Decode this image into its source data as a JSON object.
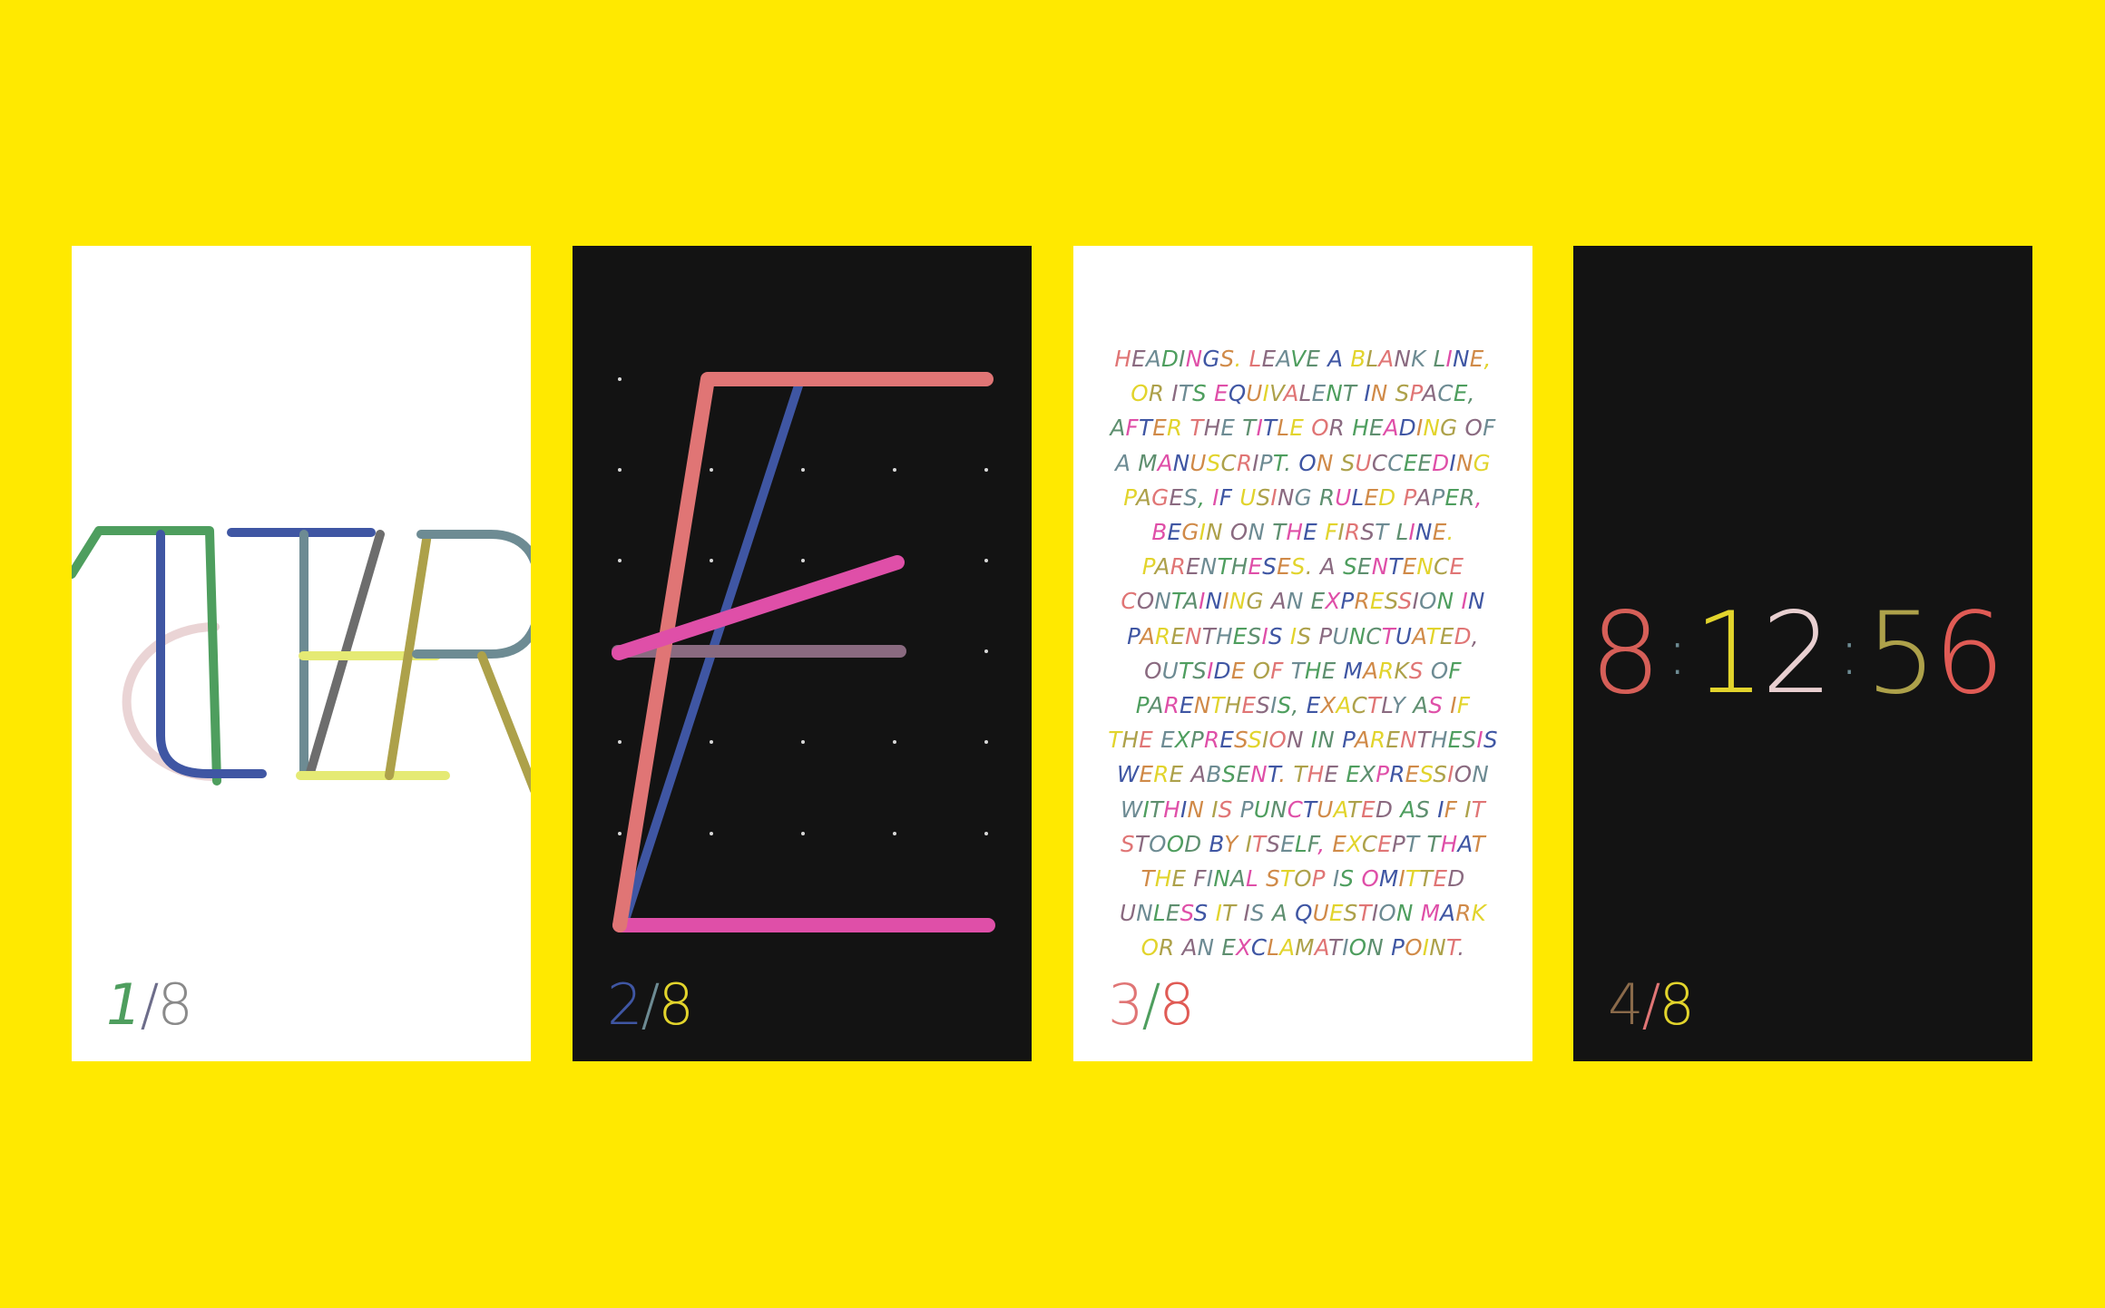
{
  "palette": {
    "background": "#ffe900",
    "green": "#4e9e5e",
    "blue": "#3f56a3",
    "slate": "#6d8b93",
    "olive": "#ada14a",
    "pink": "#e8cfd0",
    "lime": "#e5ea74",
    "salmon": "#e07575",
    "magenta": "#df4fa8",
    "yellow": "#e2d42c",
    "grey": "#8a8a8a",
    "coral": "#e05b55"
  },
  "cards": [
    {
      "theme": "white",
      "pager": {
        "current": "1",
        "separator": "/",
        "total": "8"
      }
    },
    {
      "theme": "dark",
      "pager": {
        "current": "2",
        "separator": "/",
        "total": "8"
      }
    },
    {
      "theme": "white",
      "pager": {
        "current": "3",
        "separator": "/",
        "total": "8"
      },
      "verse_lines": [
        "HEADINGS. LEAVE A BLANK LINE,",
        "OR ITS EQUIVALENT IN SPACE,",
        "AFTER THE TITLE OR HEADING OF",
        "A MANUSCRIPT. ON SUCCEEDING",
        "PAGES, IF USING RULED PAPER,",
        "BEGIN ON THE FIRST LINE.",
        "PARENTHESES. A SENTENCE",
        "CONTAINING AN EXPRESSION IN",
        "PARENTHESIS IS PUNCTUATED,",
        "OUTSIDE OF THE MARKS OF",
        "PARENTHESIS, EXACTLY AS IF",
        "THE EXPRESSION IN PARENTHESIS",
        "WERE ABSENT. THE EXPRESSION",
        "WITHIN IS PUNCTUATED AS IF IT",
        "STOOD BY ITSELF, EXCEPT THAT",
        "THE FINAL STOP IS OMITTED",
        "UNLESS IT IS A QUESTION MARK",
        "OR AN EXCLAMATION POINT."
      ]
    },
    {
      "theme": "dark",
      "pager": {
        "current": "4",
        "separator": "/",
        "total": "8"
      },
      "clock": {
        "hours": "8",
        "minutes": "12",
        "seconds": "56",
        "separator": ":"
      }
    }
  ],
  "icons": {
    "card1": "letter-glyphs-illustration",
    "card2": "letter-e-construction-illustration"
  }
}
